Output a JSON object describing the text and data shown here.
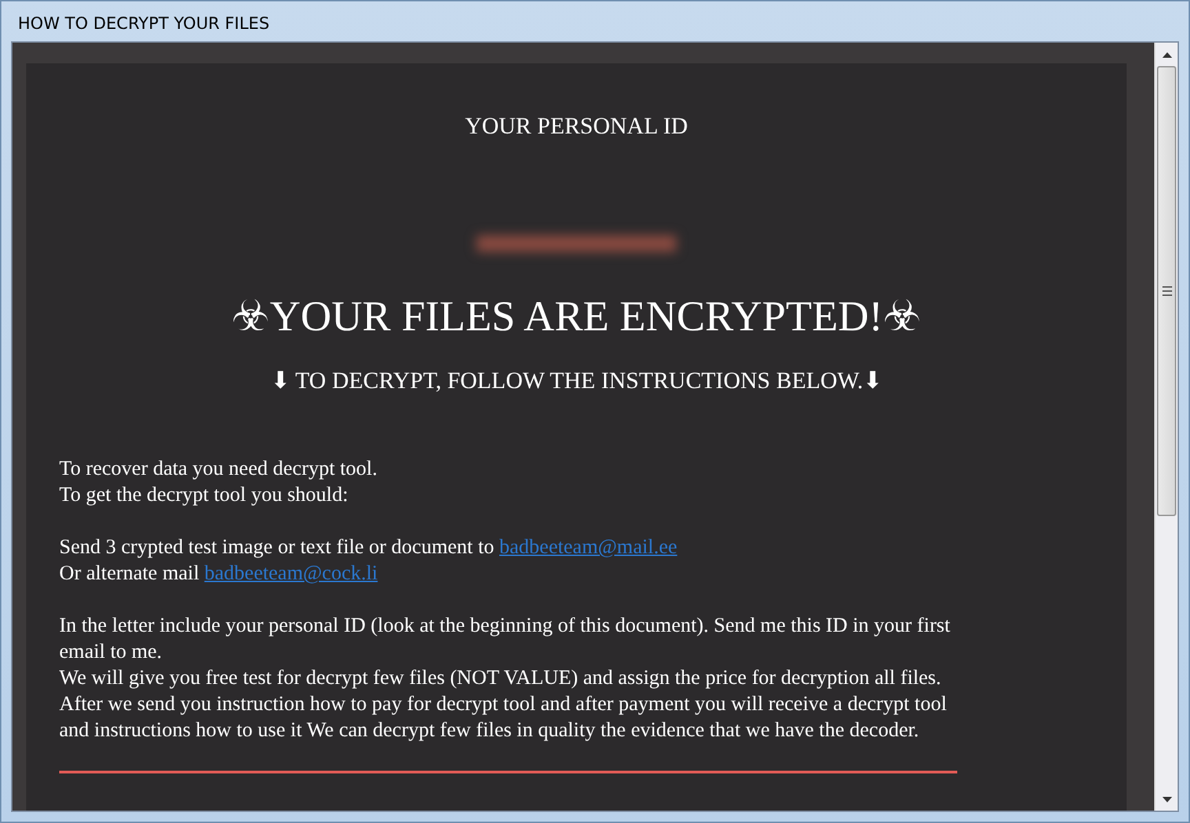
{
  "window": {
    "title": "HOW TO DECRYPT YOUR FILES"
  },
  "personal_id_heading": "YOUR PERSONAL ID",
  "headline": "☣YOUR FILES ARE ENCRYPTED!☣",
  "subheading": "⬇ TO DECRYPT, FOLLOW THE INSTRUCTIONS BELOW.⬇",
  "blocks": [
    {
      "lines": [
        {
          "text": "To recover data you need decrypt tool."
        },
        {
          "text": "To get the decrypt tool you should:"
        }
      ]
    },
    {
      "lines": [
        {
          "text": "Send 3 crypted test image or text file or document to",
          "link": "badbeeteam@mail.ee"
        },
        {
          "text": "Or alternate mail",
          "link": "badbeeteam@cock.li"
        }
      ]
    },
    {
      "lines": [
        {
          "text": "In the letter include your personal ID (look at the beginning of this document). Send me this ID in your first email to me."
        },
        {
          "text": "We will give you free test for decrypt few files (NOT VALUE) and assign the price for decryption all files."
        },
        {
          "text": "After we send you instruction how to pay for decrypt tool and after payment you will receive a decrypt tool and instructions how to use it We can decrypt few files in quality the evidence that we have the decoder."
        }
      ]
    }
  ]
}
